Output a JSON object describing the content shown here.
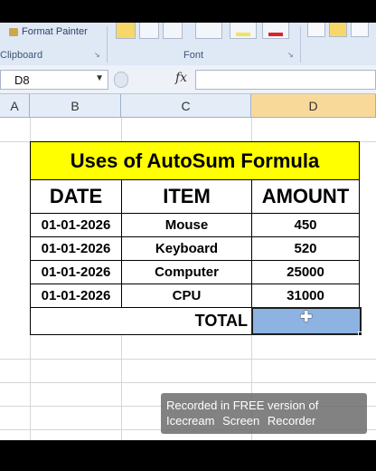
{
  "ribbon": {
    "format_painter_label": "Format Painter",
    "groups": [
      "Clipboard",
      "Font"
    ]
  },
  "formula_bar": {
    "name_box": "D8",
    "fx_label": "fx",
    "formula": ""
  },
  "columns": [
    "A",
    "B",
    "C",
    "D"
  ],
  "selected_column": "D",
  "table": {
    "title": "Uses of AutoSum Formula",
    "headers": [
      "DATE",
      "ITEM",
      "AMOUNT"
    ],
    "rows": [
      [
        "01-01-2026",
        "Mouse",
        "450"
      ],
      [
        "01-01-2026",
        "Keyboard",
        "520"
      ],
      [
        "01-01-2026",
        "Computer",
        "25000"
      ],
      [
        "01-01-2026",
        "CPU",
        "31000"
      ]
    ],
    "total_label": "TOTAL",
    "total_value": ""
  },
  "colors": {
    "title_fill": "#ffff00",
    "selected_cell_fill": "#8db3e2",
    "selected_col_header": "#f9d99a"
  },
  "watermark": {
    "line1": "Recorded in FREE version of",
    "line2": "Icecream Screen Recorder"
  }
}
